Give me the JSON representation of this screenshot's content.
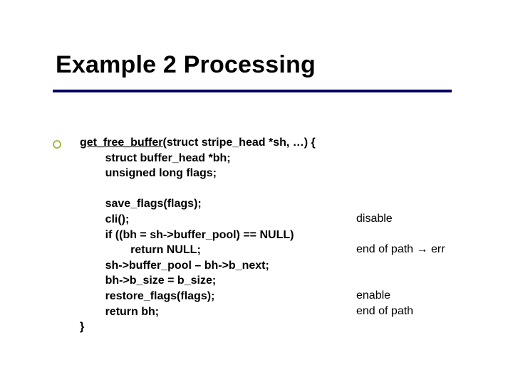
{
  "title": "Example 2 Processing",
  "code": {
    "sig_func": "get_free_buffer",
    "sig_rest": "(struct stripe_head *sh, …) {",
    "decl1": "        struct buffer_head *bh;",
    "decl2": "        unsigned long flags;",
    "blank1": "",
    "l1": "        save_flags(flags);",
    "l2": "        cli();",
    "l3": "        if ((bh = sh->buffer_pool) == NULL)",
    "l4": "                return NULL;",
    "l5": "        sh->buffer_pool – bh->b_next;",
    "l6": "        bh->b_size = b_size;",
    "l7": "        restore_flags(flags);",
    "l8": "        return bh;",
    "close": "}"
  },
  "annotations": {
    "a1": "disable",
    "a2": "end of path → err",
    "a3": "enable",
    "a4": "end of path"
  }
}
